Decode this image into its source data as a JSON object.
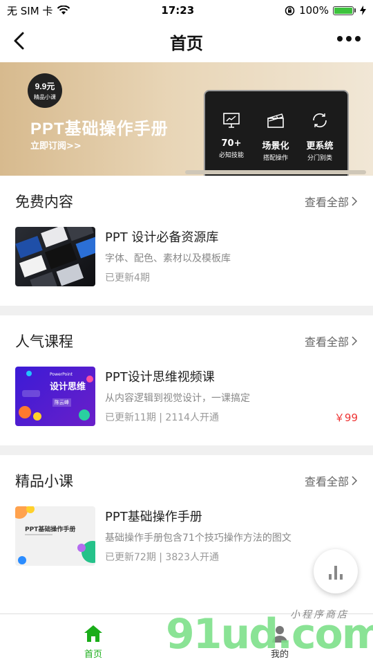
{
  "status_bar": {
    "carrier": "无 SIM 卡",
    "time": "17:23",
    "battery": "100%"
  },
  "nav": {
    "title": "首页"
  },
  "banner": {
    "badge_price": "9.9元",
    "badge_text": "精品小课",
    "title": "PPT基础操作手册",
    "subtitle": "立即订阅>>",
    "features": [
      {
        "value": "70+",
        "label": "必知技能",
        "icon": "presentation-icon"
      },
      {
        "value": "场景化",
        "label": "搭配操作",
        "icon": "clapperboard-icon"
      },
      {
        "value": "更系统",
        "label": "分门别类",
        "icon": "refresh-icon"
      }
    ]
  },
  "sections": [
    {
      "title": "免费内容",
      "more": "查看全部",
      "item": {
        "name": "PPT 设计必备资源库",
        "desc": "字体、配色、素材以及模板库",
        "meta": "已更新4期",
        "price": ""
      }
    },
    {
      "title": "人气课程",
      "more": "查看全部",
      "item": {
        "name": "PPT设计思维视频课",
        "desc": "从内容逻辑到视觉设计，一课搞定",
        "meta": "已更新11期 | 2114人开通",
        "price": "￥99",
        "thumb_text": {
          "top": "PowerPoint",
          "title": "设计思维",
          "name": "陈云峰"
        }
      }
    },
    {
      "title": "精品小课",
      "more": "查看全部",
      "item": {
        "name": "PPT基础操作手册",
        "desc": "基础操作手册包含71个技巧操作方法的图文",
        "meta": "已更新72期 | 3823人开通",
        "price": "",
        "thumb_text": {
          "title": "PPT基础操作手册"
        }
      }
    }
  ],
  "tabbar": {
    "home": "首页",
    "mine": "我的"
  },
  "watermark": {
    "brand": "91ud.com",
    "tagline": "小程序商店"
  },
  "colors": {
    "accent": "#1aad19",
    "price": "#e33333"
  }
}
